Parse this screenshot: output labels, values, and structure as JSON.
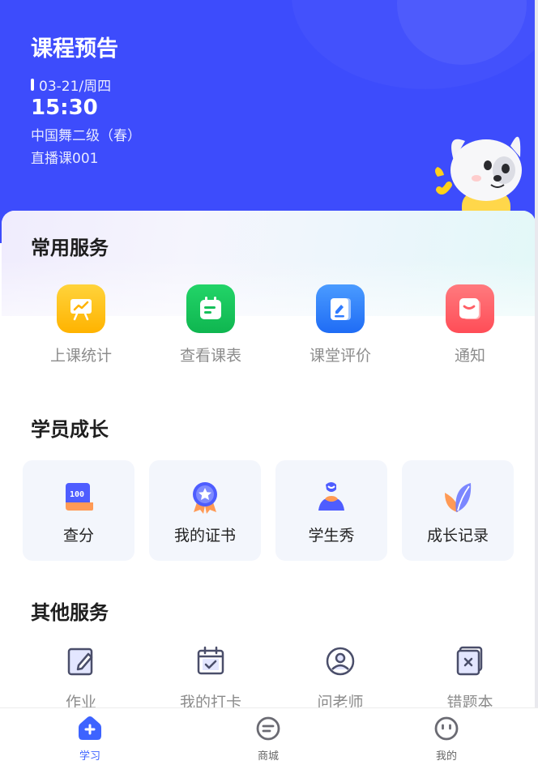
{
  "header": {
    "title": "课程预告",
    "date": "03-21/周四",
    "time": "15:30",
    "course_name": "中国舞二级（春）",
    "course_type": "直播课001",
    "bg_color": "#3d4cfc"
  },
  "common_services": {
    "title": "常用服务",
    "items": [
      {
        "label": "上课统计",
        "icon": "presentation-chart-icon",
        "color": "#ffc21a"
      },
      {
        "label": "查看课表",
        "icon": "calendar-list-icon",
        "color": "#16c05a"
      },
      {
        "label": "课堂评价",
        "icon": "edit-note-icon",
        "color": "#2f7bff"
      },
      {
        "label": "通知",
        "icon": "message-icon",
        "color": "#ff5f66"
      }
    ]
  },
  "growth": {
    "title": "学员成长",
    "items": [
      {
        "label": "查分",
        "icon": "score-icon",
        "icon_text": "100"
      },
      {
        "label": "我的证书",
        "icon": "medal-icon"
      },
      {
        "label": "学生秀",
        "icon": "student-icon"
      },
      {
        "label": "成长记录",
        "icon": "leaf-icon"
      }
    ]
  },
  "other_services": {
    "title": "其他服务",
    "items": [
      {
        "label": "作业",
        "icon": "homework-icon"
      },
      {
        "label": "我的打卡",
        "icon": "checkin-calendar-icon"
      },
      {
        "label": "问老师",
        "icon": "teacher-icon"
      },
      {
        "label": "错题本",
        "icon": "wrong-book-icon"
      }
    ]
  },
  "tabbar": {
    "items": [
      {
        "label": "学习",
        "icon": "study-icon",
        "active": true
      },
      {
        "label": "商城",
        "icon": "shop-icon",
        "active": false
      },
      {
        "label": "我的",
        "icon": "profile-icon",
        "active": false
      }
    ],
    "active_color": "#3d63ff"
  }
}
